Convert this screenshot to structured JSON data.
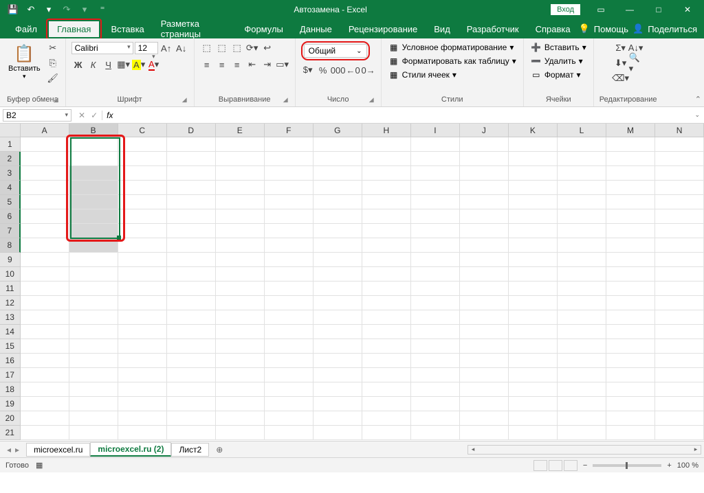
{
  "title": "Автозамена - Excel",
  "qat": {
    "save": "💾",
    "undo": "↶",
    "redo": "↷"
  },
  "login": "Вход",
  "tabs": [
    "Файл",
    "Главная",
    "Вставка",
    "Разметка страницы",
    "Формулы",
    "Данные",
    "Рецензирование",
    "Вид",
    "Разработчик",
    "Справка"
  ],
  "active_tab": 1,
  "tell_me": "Помощь",
  "share": "Поделиться",
  "ribbon": {
    "clipboard": {
      "paste": "Вставить",
      "label": "Буфер обмена"
    },
    "font": {
      "name": "Calibri",
      "size": "12",
      "label": "Шрифт"
    },
    "align": {
      "label": "Выравнивание"
    },
    "number": {
      "format": "Общий",
      "label": "Число"
    },
    "styles": {
      "cond": "Условное форматирование",
      "table": "Форматировать как таблицу",
      "cell": "Стили ячеек",
      "label": "Стили"
    },
    "cells": {
      "insert": "Вставить",
      "delete": "Удалить",
      "format": "Формат",
      "label": "Ячейки"
    },
    "editing": {
      "label": "Редактирование"
    }
  },
  "namebox": "B2",
  "cols": [
    "A",
    "B",
    "C",
    "D",
    "E",
    "F",
    "G",
    "H",
    "I",
    "J",
    "K",
    "L",
    "M",
    "N"
  ],
  "row_count": 21,
  "selection": {
    "col": "B",
    "rows_from": 2,
    "rows_to": 8
  },
  "sheets": [
    "microexcel.ru",
    "microexcel.ru (2)",
    "Лист2"
  ],
  "active_sheet": 1,
  "status": "Готово",
  "zoom": "100 %"
}
